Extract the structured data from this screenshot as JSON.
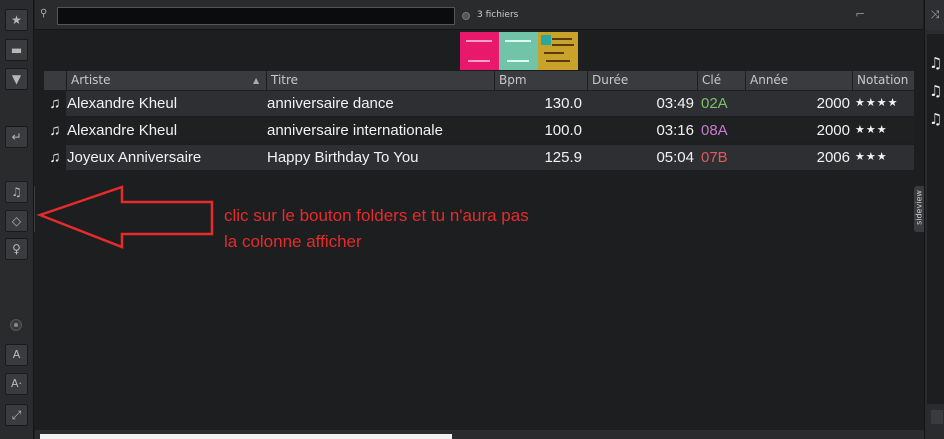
{
  "search": {
    "value": "",
    "icon": "search-icon"
  },
  "file_count": "3 fichiers",
  "columns": [
    {
      "label": "Artiste"
    },
    {
      "label": "Titre"
    },
    {
      "label": "Bpm"
    },
    {
      "label": "Durée"
    },
    {
      "label": "Clé"
    },
    {
      "label": "Année"
    },
    {
      "label": "Notation"
    }
  ],
  "tracks": [
    {
      "artist": "Alexandre Kheul",
      "title": "anniversaire dance",
      "bpm": "130.0",
      "duration": "03:49",
      "key": "02A",
      "key_color": "#7cc168",
      "year": "2000",
      "rating": "★★★★"
    },
    {
      "artist": "Alexandre Kheul",
      "title": "anniversaire internationale",
      "bpm": "100.0",
      "duration": "03:16",
      "key": "08A",
      "key_color": "#c77ad0",
      "year": "2000",
      "rating": "★★★"
    },
    {
      "artist": "Joyeux Anniversaire",
      "title": "Happy Birthday To You",
      "bpm": "125.9",
      "duration": "05:04",
      "key": "07B",
      "key_color": "#e05a5a",
      "year": "2006",
      "rating": "★★★"
    }
  ],
  "tabs": {
    "folders": "folders",
    "sideview": "sideview"
  },
  "left_bar": {
    "letter_a": "A",
    "letter_a2": "A"
  },
  "annotation": {
    "text": "clic sur le bouton folders et tu n'aura pas la colonne afficher"
  },
  "colors": {
    "annotation": "#e62b2b",
    "background": "#1d1e20"
  }
}
